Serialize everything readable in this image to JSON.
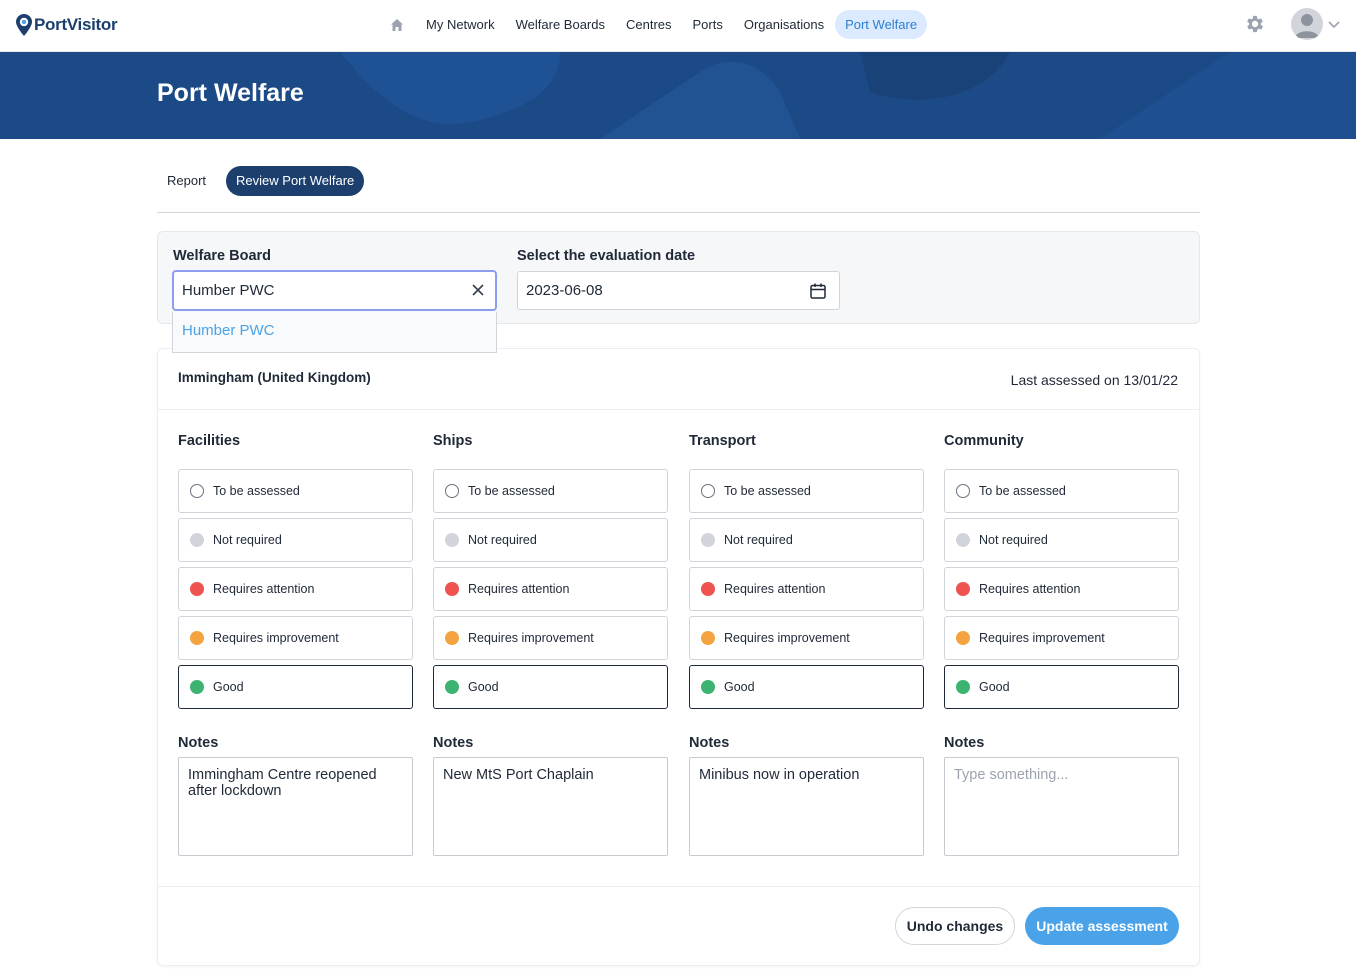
{
  "app": {
    "brand": "PortVisitor"
  },
  "nav": {
    "items": [
      {
        "label": "My Network"
      },
      {
        "label": "Welfare Boards"
      },
      {
        "label": "Centres"
      },
      {
        "label": "Ports"
      },
      {
        "label": "Organisations"
      },
      {
        "label": "Port Welfare",
        "active": true
      }
    ],
    "icons": [
      "home-icon",
      "gear-icon",
      "avatar",
      "chevron-down-icon"
    ]
  },
  "banner": {
    "title": "Port Welfare"
  },
  "tabs": [
    {
      "label": "Report",
      "active": false
    },
    {
      "label": "Review Port Welfare",
      "active": true
    }
  ],
  "filters": {
    "welfare_board_label": "Welfare Board",
    "welfare_board_value": "Humber PWC",
    "welfare_board_options": [
      "Humber PWC"
    ],
    "date_label": "Select the evaluation date",
    "date_value": "2023-06-08"
  },
  "assessment": {
    "port_name": "Immingham (United Kingdom)",
    "last_assessed": "Last assessed on 13/01/22",
    "option_labels": [
      "To be assessed",
      "Not required",
      "Requires attention",
      "Requires improvement",
      "Good"
    ],
    "notes_label": "Notes",
    "notes_placeholder": "Type something...",
    "categories": [
      {
        "title": "Facilities",
        "selected": "Good",
        "notes": "Immingham Centre reopened after lockdown"
      },
      {
        "title": "Ships",
        "selected": "Good",
        "notes": "New MtS Port Chaplain"
      },
      {
        "title": "Transport",
        "selected": "Good",
        "notes": "Minibus now in operation"
      },
      {
        "title": "Community",
        "selected": "Good",
        "notes": ""
      }
    ]
  },
  "actions": {
    "undo_label": "Undo changes",
    "update_label": "Update assessment"
  },
  "colors": {
    "brand_dark": "#1c3f6e",
    "accent": "#4aa3e8",
    "status_red": "#ef5350",
    "status_orange": "#f4a340",
    "status_green": "#3cb371",
    "status_grey": "#d1d5db"
  }
}
